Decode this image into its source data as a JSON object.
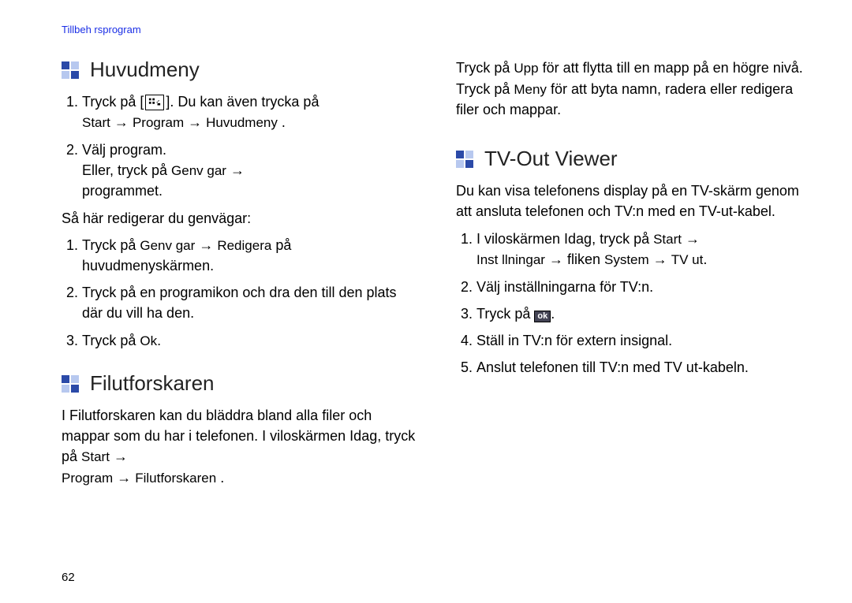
{
  "header": "Tillbeh rsprogram",
  "pageNumber": "62",
  "arrow": "→",
  "ui": {
    "start": "Start",
    "program": "Program",
    "huvudmeny": "Huvudmeny",
    "genvagar": "Genv gar",
    "redigera": "Redigera",
    "ok": "Ok",
    "filutforskaren": "Filutforskaren",
    "upp": "Upp",
    "meny": "Meny",
    "installningar": "Inst llningar",
    "system": "System",
    "tvut": "TV ut"
  },
  "huvudmeny": {
    "title": "Huvudmeny",
    "step1a": "Tryck på [",
    "step1b": "]. Du kan även trycka på",
    "step1c": ".",
    "step2a": "Välj program.",
    "step2b": "Eller, tryck på ",
    "step2c": "programmet.",
    "redigIntro": "Så här redigerar du genvägar:",
    "r1a": "Tryck på ",
    "r1b": " på huvudmenyskärmen.",
    "r2": "Tryck på en programikon och dra den till den plats där du vill ha den.",
    "r3a": "Tryck på ",
    "r3b": "."
  },
  "filutforskaren": {
    "title": "Filutforskaren",
    "p1a": "I Filutforskaren kan du bläddra bland alla filer och mappar som du har i telefonen. I viloskärmen Idag, tryck på ",
    "p1b": ".",
    "col2a": "Tryck på ",
    "col2b": " för att flytta till en mapp på en högre nivå. Tryck på ",
    "col2c": " för att byta namn, radera eller redigera filer och mappar."
  },
  "tvout": {
    "title": "TV-Out Viewer",
    "intro": "Du kan visa telefonens display på en TV-skärm genom att ansluta telefonen och TV:n med en TV-ut-kabel.",
    "s1a": "I viloskärmen Idag, tryck på ",
    "s1b": " fliken ",
    "s1c": ".",
    "s2": "Välj inställningarna för TV:n.",
    "s3a": "Tryck på ",
    "s3b": ".",
    "s4": "Ställ in TV:n för extern insignal.",
    "s5": "Anslut telefonen till TV:n med TV ut-kabeln."
  }
}
